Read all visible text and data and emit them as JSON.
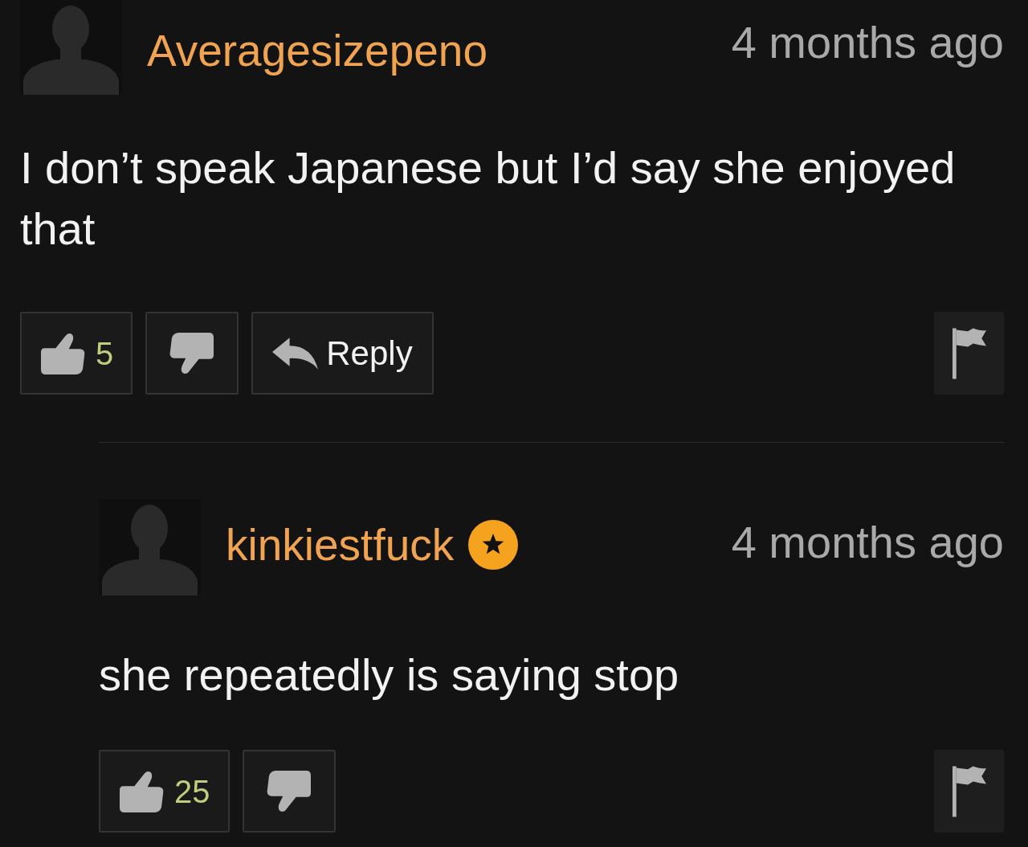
{
  "comments": [
    {
      "username": "Averagesizepeno",
      "badge": false,
      "time": "4 months ago",
      "text": "I don’t speak Japanese but I’d say she enjoyed that",
      "likes": "5",
      "reply": "Reply",
      "children": [
        {
          "username": "kinkiestfuck",
          "badge": true,
          "time": "4 months ago",
          "text": "she repeatedly is saying stop",
          "likes": "25"
        }
      ]
    }
  ]
}
